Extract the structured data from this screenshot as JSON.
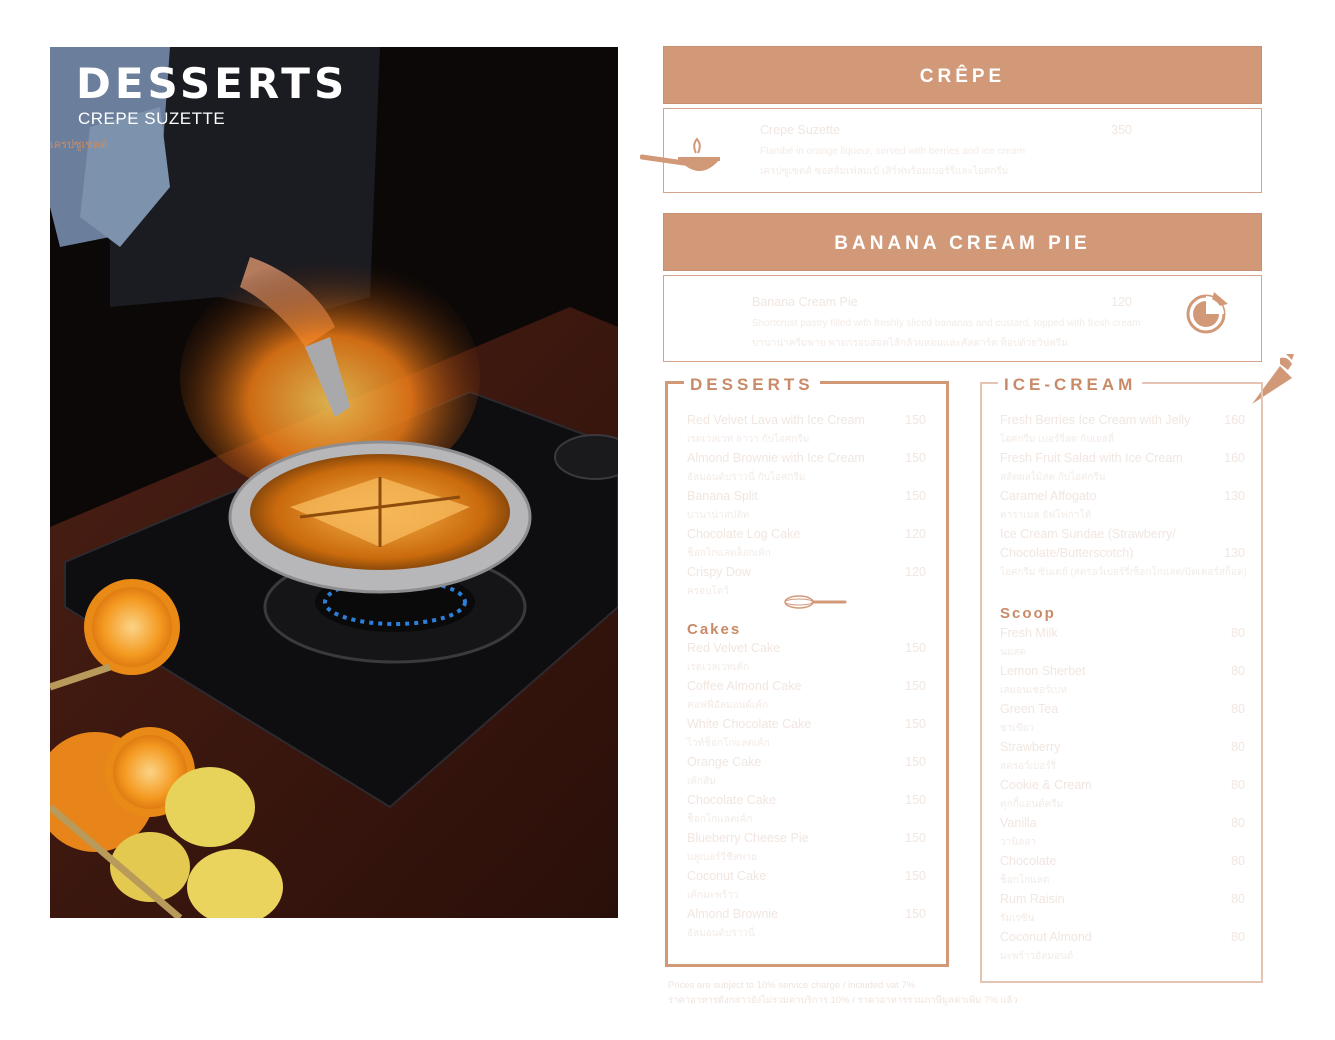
{
  "photo": {
    "title": "DESSERTS",
    "subtitle": "CREPE SUZETTE",
    "thai": "เครปซูเซตต์"
  },
  "crepe": {
    "header": "CRÊPE",
    "items": [
      {
        "name": "Crepe Suzette",
        "price": "350",
        "desc": "Flambé in orange liqueur, served with berries and ice cream",
        "desc_th": "เครปซูเซตต์ ซอสส้มเฟลมเบ้ เสิร์ฟพร้อมเบอร์รี่และไอศกรีม"
      }
    ],
    "icon": "frying-pan-icon"
  },
  "banana": {
    "header": "BANANA CREAM PIE",
    "items": [
      {
        "name": "Banana Cream Pie",
        "price": "120",
        "desc": "Shortcrust pastry filled with freshly sliced bananas and custard, topped with fresh cream",
        "desc_th": "บานาน่าครีมพาย พายกรอบสอดไส้กล้วยหอมและคัสตาร์ด ท็อปด้วยวิปครีม"
      }
    ],
    "icon": "pie-icon"
  },
  "desserts": {
    "header": "DESSERTS",
    "items": [
      {
        "name": "Red Velvet Lava with Ice Cream",
        "price": "150",
        "desc": "เรดเวลเวท ลาวา กับไอศกรีม"
      },
      {
        "name": "Almond Brownie with Ice Cream",
        "price": "150",
        "desc": "อัลมอนด์บราวนี่ กับไอศกรีม"
      },
      {
        "name": "Banana Split",
        "price": "150",
        "desc": "บานาน่าสปลิท"
      },
      {
        "name": "Chocolate Log Cake",
        "price": "120",
        "desc": "ช็อกโกแลตล็อกเค้ก"
      },
      {
        "name": "Crispy Dow",
        "price": "120",
        "desc": "ครอบโดว์"
      }
    ],
    "cakes_title": "Cakes",
    "cakes": [
      {
        "name": "Red Velvet Cake",
        "price": "150",
        "desc": "เรดเวลเวทเค้ก"
      },
      {
        "name": "Coffee Almond Cake",
        "price": "150",
        "desc": "คอฟฟี่อัลมอนด์เค้ก"
      },
      {
        "name": "White Chocolate Cake",
        "price": "150",
        "desc": "ไวท์ช็อกโกแลตเค้ก"
      },
      {
        "name": "Orange Cake",
        "price": "150",
        "desc": "เค้กส้ม"
      },
      {
        "name": "Chocolate Cake",
        "price": "150",
        "desc": "ช็อกโกแลตเค้ก"
      },
      {
        "name": "Blueberry Cheese Pie",
        "price": "150",
        "desc": "บลูเบอร์รี่ชีสพาย"
      },
      {
        "name": "Coconut Cake",
        "price": "150",
        "desc": "เค้กมะพร้าว"
      },
      {
        "name": "Almond Brownie",
        "price": "150",
        "desc": "อัลมอนด์บราวนี่"
      }
    ]
  },
  "icecream": {
    "header": "ICE-CREAM",
    "items": [
      {
        "name": "Fresh Berries Ice Cream with Jelly",
        "price": "160",
        "desc": "ไอศกรีม เบอร์รี่สด กับเยลลี่"
      },
      {
        "name": "Fresh Fruit Salad with Ice Cream",
        "price": "160",
        "desc": "สลัดผลไม้สด กับไอศกรีม"
      },
      {
        "name": "Caramel Affogato",
        "price": "130",
        "desc": "คาราเมล อัฟโฟกาโต้"
      },
      {
        "name": "Ice Cream Sundae (Strawberry/",
        "name2": "Chocolate/Butterscotch)",
        "price": "130",
        "desc": "ไอศกรีม ซันเดย์ (สตรอว์เบอร์รี่/ช็อกโกแลต/บัตเตอร์สก็อต)"
      }
    ],
    "scoop_title": "Scoop",
    "scoop": [
      {
        "name": "Fresh Milk",
        "price": "80",
        "desc": "นมสด"
      },
      {
        "name": "Lemon Sherbet",
        "price": "80",
        "desc": "เลมอนเชอร์เบท"
      },
      {
        "name": "Green Tea",
        "price": "80",
        "desc": "ชาเขียว"
      },
      {
        "name": "Strawberry",
        "price": "80",
        "desc": "สตรอว์เบอร์รี่"
      },
      {
        "name": "Cookie & Cream",
        "price": "80",
        "desc": "คุกกี้แอนด์ครีม"
      },
      {
        "name": "Vanilla",
        "price": "80",
        "desc": "วานิลลา"
      },
      {
        "name": "Chocolate",
        "price": "80",
        "desc": "ช็อกโกแลต"
      },
      {
        "name": "Rum Raisin",
        "price": "80",
        "desc": "รัมเรซิน"
      },
      {
        "name": "Coconut Almond",
        "price": "80",
        "desc": "มะพร้าวอัลมอนด์"
      }
    ]
  },
  "footer": {
    "line1": "Prices are subject to 10% service charge / included vat 7%",
    "line2": "ราคาอาหารดังกล่าวยังไม่รวมค่าบริการ 10% / ราคาอาหารรวมภาษีมูลค่าเพิ่ม 7% แล้ว"
  },
  "colors": {
    "accent": "#d29979",
    "text_faint": "#f1e6e0"
  }
}
